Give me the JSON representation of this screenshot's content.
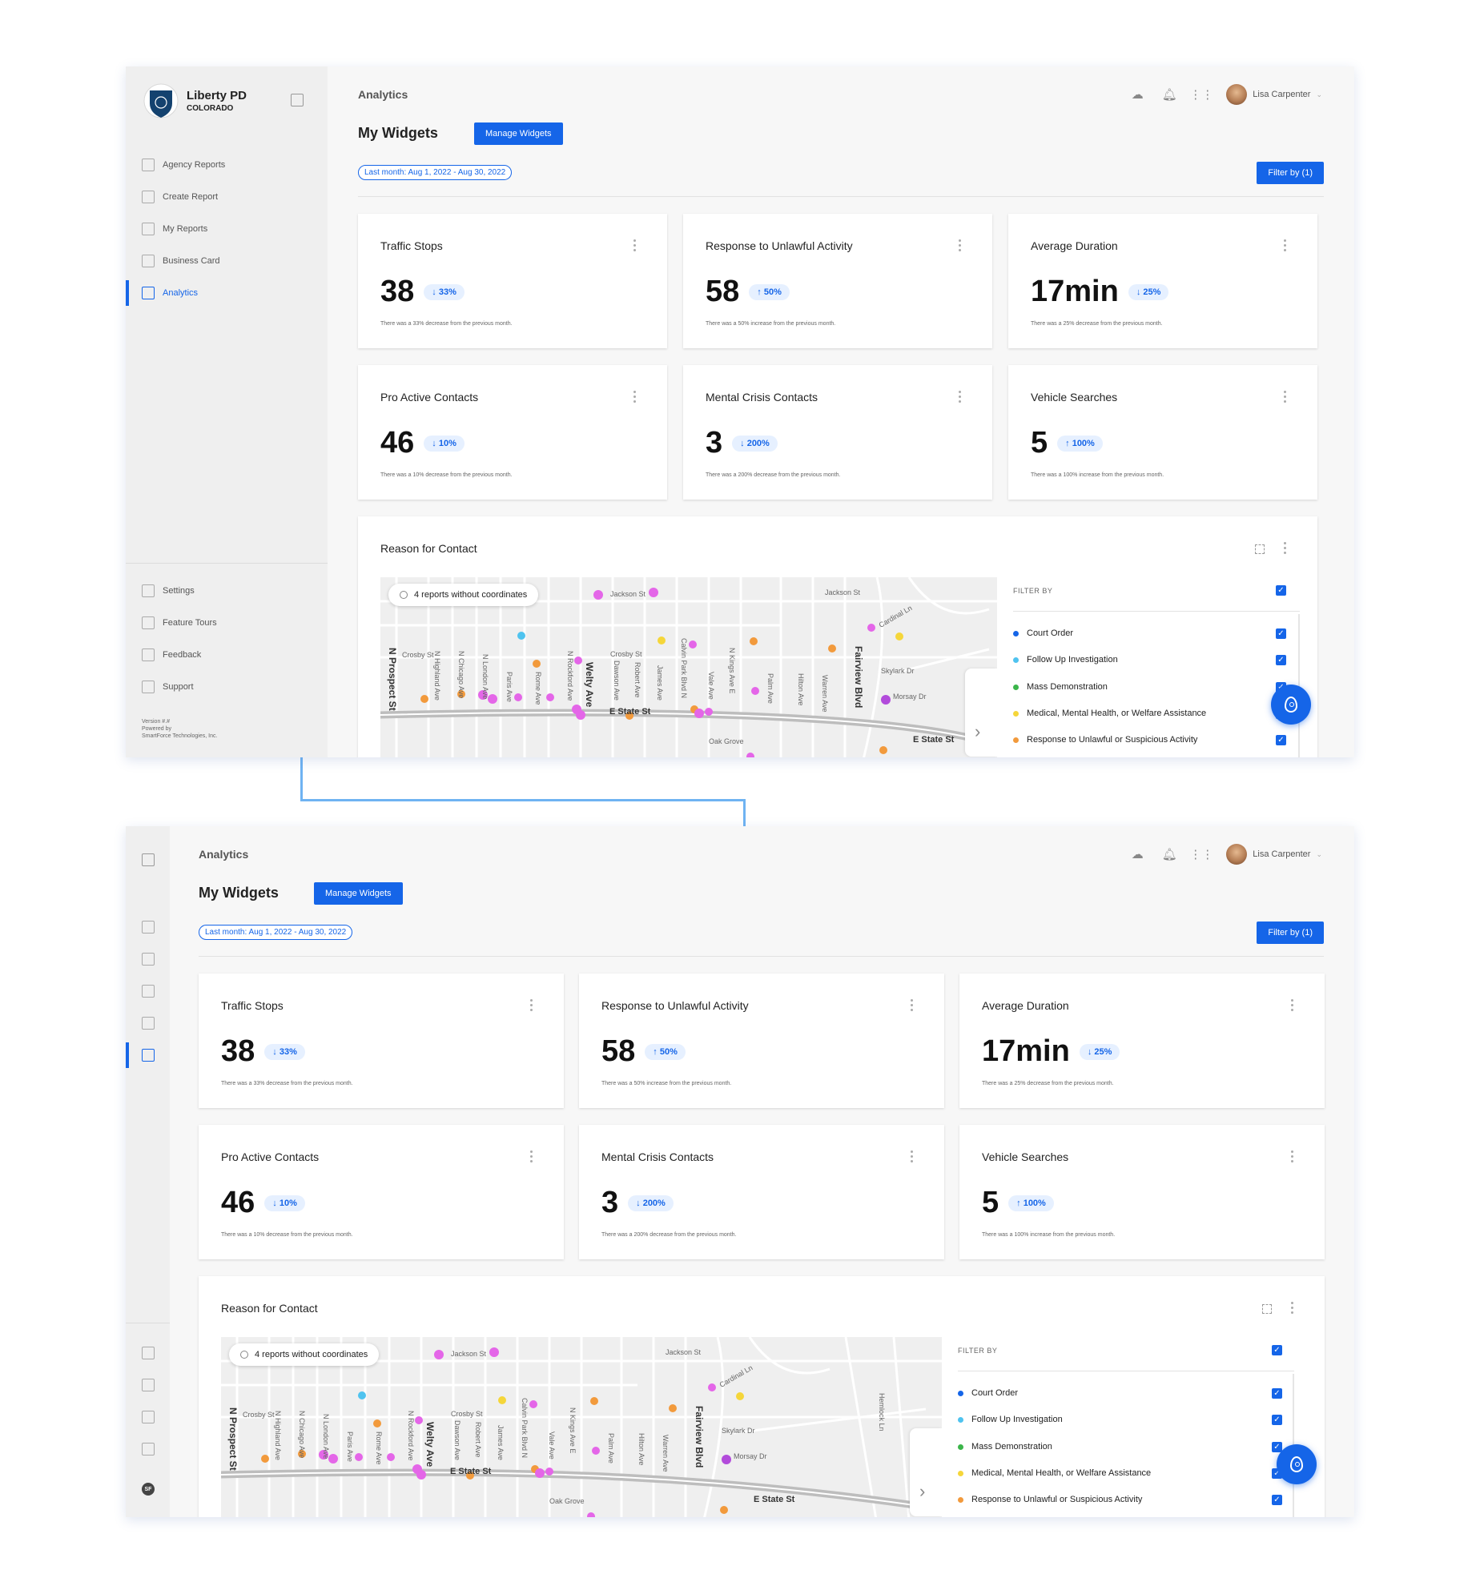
{
  "colors": {
    "accent": "#1565e8",
    "connector": "#6fb3f2"
  },
  "brand": {
    "name": "Liberty PD",
    "state": "COLORADO"
  },
  "nav": {
    "items": [
      {
        "label": "Agency Reports",
        "icon": "users-icon"
      },
      {
        "label": "Create Report",
        "icon": "create-report-icon"
      },
      {
        "label": "My Reports",
        "icon": "reports-icon"
      },
      {
        "label": "Business Card",
        "icon": "business-card-icon"
      },
      {
        "label": "Analytics",
        "icon": "analytics-icon",
        "active": true
      }
    ],
    "bottom": [
      {
        "label": "Settings",
        "icon": "gear-icon"
      },
      {
        "label": "Feature Tours",
        "icon": "star-icon"
      },
      {
        "label": "Feedback",
        "icon": "feedback-icon"
      },
      {
        "label": "Support",
        "icon": "help-icon"
      }
    ],
    "version": "Version #.#",
    "powered1": "Powered by",
    "powered2": "SmartForce Technologies, Inc.",
    "sf_logo": "SF"
  },
  "header": {
    "title": "Analytics",
    "user": "Lisa Carpenter",
    "icons": [
      "cloud-sync-icon",
      "bell-icon",
      "apps-grid-icon"
    ]
  },
  "widgets": {
    "title": "My Widgets",
    "manage_label": "Manage Widgets",
    "date_range": "Last month: Aug 1, 2022 - Aug 30, 2022",
    "filter_label": "Filter by (1)"
  },
  "cards": [
    {
      "title": "Traffic Stops",
      "value": "38",
      "delta": "↓ 33%",
      "note": "There was a 33% decrease from the previous month."
    },
    {
      "title": "Response to Unlawful Activity",
      "value": "58",
      "delta": "↑ 50%",
      "note": "There was a 50% increase from the previous month."
    },
    {
      "title": "Average Duration",
      "value": "17min",
      "delta": "↓ 25%",
      "note": "There was a 25% decrease from the previous month."
    },
    {
      "title": "Pro Active Contacts",
      "value": "46",
      "delta": "↓ 10%",
      "note": "There was a 10% decrease from the previous month."
    },
    {
      "title": "Mental Crisis Contacts",
      "value": "3",
      "delta": "↓ 200%",
      "note": "There was a 200% decrease from the previous month."
    },
    {
      "title": "Vehicle Searches",
      "value": "5",
      "delta": "↑ 100%",
      "note": "There was a 100% increase from the previous month."
    }
  ],
  "map_widget": {
    "title": "Reason for Contact",
    "reports_without_coords": "4 reports without coordinates",
    "filter_by": "FILTER BY",
    "categories": [
      {
        "label": "Court Order",
        "color": "#1565e8"
      },
      {
        "label": "Follow Up Investigation",
        "color": "#4fc3ef"
      },
      {
        "label": "Mass Demonstration",
        "color": "#3bb54a"
      },
      {
        "label": "Medical, Mental Health, or Welfare Assistance",
        "color": "#f5d63a"
      },
      {
        "label": "Response to Unlawful or Suspicious Activity",
        "color": "#f29a3c"
      }
    ],
    "streets": {
      "jackson1": "Jackson St",
      "jackson2": "Jackson St",
      "crosby1": "Crosby St",
      "crosby2": "Crosby St",
      "prospect": "N Prospect St",
      "highland": "N Highland Ave",
      "chicago": "N Chicago Ave",
      "london": "N London Ave",
      "paris": "Paris Ave",
      "rome": "Rome Ave",
      "rockford": "N Rockford Ave",
      "welty": "Welty Ave",
      "dawson": "Dawson Ave",
      "robert": "Robert Ave",
      "james": "James Ave",
      "calvin": "Calvin Park Blvd N",
      "vale": "Vale Ave",
      "kings": "N Kings Ave E",
      "palm": "Palm Ave",
      "hilton": "Hilton Ave",
      "warren": "Warren Ave",
      "fairview": "Fairview Blvd",
      "skylark": "Skylark Dr",
      "morsay": "Morsay Dr",
      "cardinal": "Cardinal Ln",
      "estate": "E State St",
      "estate2": "E State St",
      "oakgrove": "Oak Grove",
      "hemlock": "Hemlock Ln"
    }
  }
}
